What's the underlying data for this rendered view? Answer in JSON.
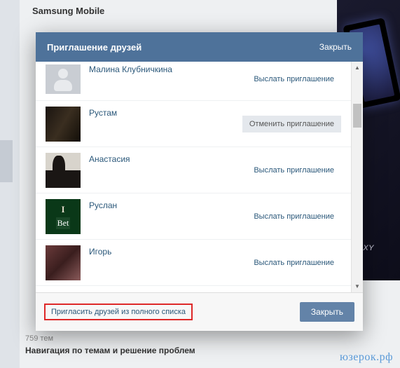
{
  "background": {
    "page_title": "Samsung Mobile",
    "ad_tagline": "GALAXY",
    "topics_count": "759 тем",
    "nav_section": "Навигация по темам и решение проблем"
  },
  "modal": {
    "title": "Приглашение друзей",
    "header_close": "Закрыть",
    "friends": [
      {
        "name": "Малина Клубничкина",
        "action": "Выслать приглашение",
        "action_type": "send"
      },
      {
        "name": "Рустам",
        "action": "Отменить приглашение",
        "action_type": "cancel"
      },
      {
        "name": "Анастасия",
        "action": "Выслать приглашение",
        "action_type": "send"
      },
      {
        "name": "Руслан",
        "action": "Выслать приглашение",
        "action_type": "send"
      },
      {
        "name": "Игорь",
        "action": "Выслать приглашение",
        "action_type": "send"
      }
    ],
    "invite_full_link": "Пригласить друзей из полного списка",
    "footer_close": "Закрыть"
  },
  "watermark": "юзерок.рф"
}
